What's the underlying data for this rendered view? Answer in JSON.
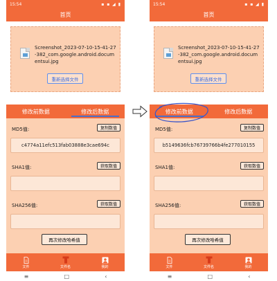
{
  "status_bar": {
    "time": "15:54"
  },
  "app_title": "首页",
  "file": {
    "name": "Screenshot_2023-07-10-15-41-27-382_com.google.android.documentsui.jpg",
    "reselect_label": "重新选择文件"
  },
  "tabs": {
    "before": "修改前数据",
    "after": "修改后数据"
  },
  "labels": {
    "md5": "MD5值:",
    "sha1": "SHA1值:",
    "sha256": "SHA256值:",
    "copy": "复制数值",
    "get": "获取数值",
    "recalc": "再次修改哈希值"
  },
  "screens": [
    {
      "md5_value": "c4774a11efc513fab03888e3cae694c"
    },
    {
      "md5_value": "b5149636fcb76739766b4fe277010155"
    }
  ],
  "nav": {
    "items": [
      "文件",
      "文件名",
      "我的"
    ]
  },
  "colors": {
    "primary": "#f26a3a",
    "panel": "#fcd0b2",
    "accent": "#4a6fc8"
  }
}
